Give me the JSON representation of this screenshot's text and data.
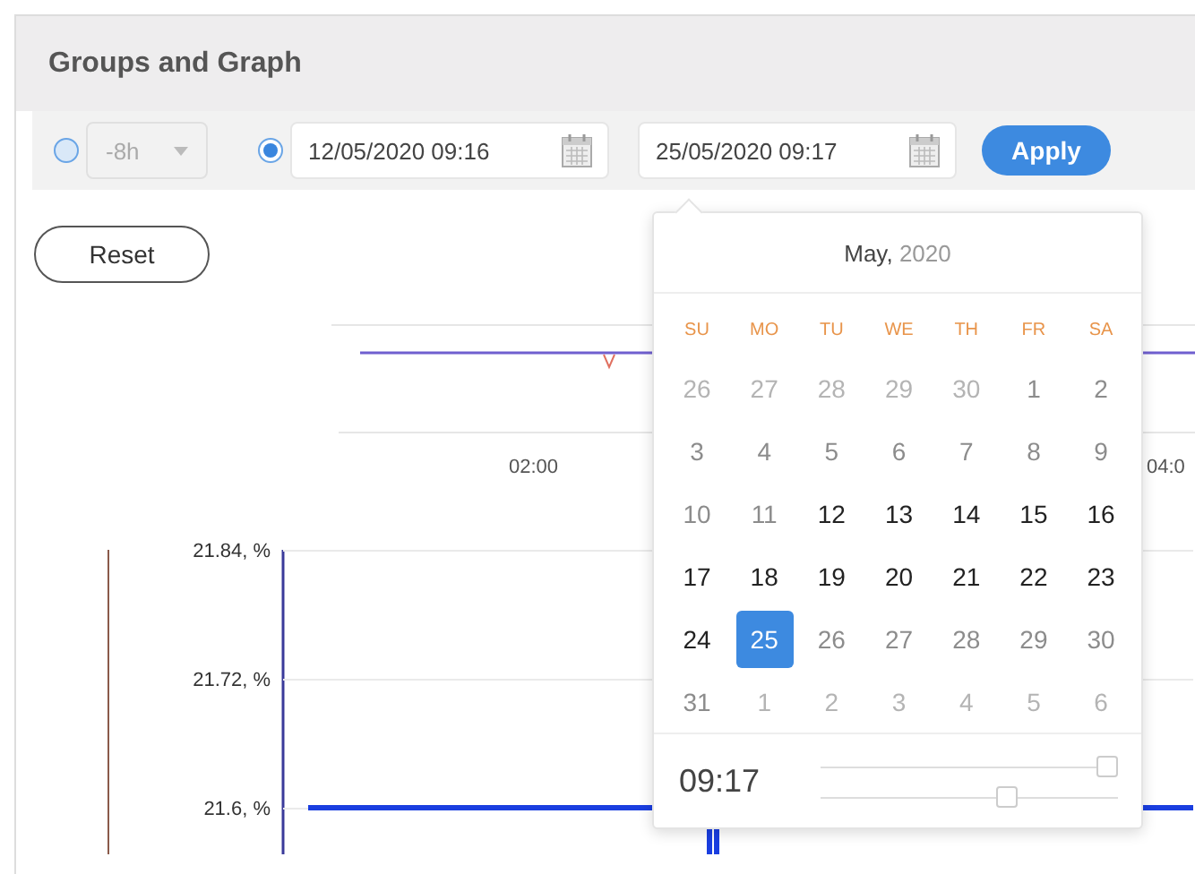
{
  "panel": {
    "title": "Groups and Graph"
  },
  "toolbar": {
    "relative": {
      "selected": false,
      "value": "-8h",
      "disabled": true
    },
    "absolute": {
      "selected": true
    },
    "from": "12/05/2020 09:16",
    "to": "25/05/2020 09:17",
    "apply": "Apply"
  },
  "reset": "Reset",
  "overview_chart": {
    "x_labels": [
      "02:00",
      "04:0"
    ]
  },
  "main_chart": {
    "y_labels": [
      "21.84, %",
      "21.72, %",
      "21.6, %"
    ]
  },
  "calendar": {
    "month": "May,",
    "year": "2020",
    "weekdays": [
      "SU",
      "MO",
      "TU",
      "WE",
      "TH",
      "FR",
      "SA"
    ],
    "days": [
      {
        "label": "26",
        "kind": "other",
        "selected": false
      },
      {
        "label": "27",
        "kind": "other",
        "selected": false
      },
      {
        "label": "28",
        "kind": "other",
        "selected": false
      },
      {
        "label": "29",
        "kind": "other",
        "selected": false
      },
      {
        "label": "30",
        "kind": "other",
        "selected": false
      },
      {
        "label": "1",
        "kind": "disabled",
        "selected": false
      },
      {
        "label": "2",
        "kind": "disabled",
        "selected": false
      },
      {
        "label": "3",
        "kind": "disabled",
        "selected": false
      },
      {
        "label": "4",
        "kind": "disabled",
        "selected": false
      },
      {
        "label": "5",
        "kind": "disabled",
        "selected": false
      },
      {
        "label": "6",
        "kind": "disabled",
        "selected": false
      },
      {
        "label": "7",
        "kind": "disabled",
        "selected": false
      },
      {
        "label": "8",
        "kind": "disabled",
        "selected": false
      },
      {
        "label": "9",
        "kind": "disabled",
        "selected": false
      },
      {
        "label": "10",
        "kind": "disabled",
        "selected": false
      },
      {
        "label": "11",
        "kind": "disabled",
        "selected": false
      },
      {
        "label": "12",
        "kind": "available",
        "selected": false
      },
      {
        "label": "13",
        "kind": "available",
        "selected": false
      },
      {
        "label": "14",
        "kind": "available",
        "selected": false
      },
      {
        "label": "15",
        "kind": "available",
        "selected": false
      },
      {
        "label": "16",
        "kind": "available",
        "selected": false
      },
      {
        "label": "17",
        "kind": "available",
        "selected": false
      },
      {
        "label": "18",
        "kind": "available",
        "selected": false
      },
      {
        "label": "19",
        "kind": "available",
        "selected": false
      },
      {
        "label": "20",
        "kind": "available",
        "selected": false
      },
      {
        "label": "21",
        "kind": "available",
        "selected": false
      },
      {
        "label": "22",
        "kind": "available",
        "selected": false
      },
      {
        "label": "23",
        "kind": "available",
        "selected": false
      },
      {
        "label": "24",
        "kind": "available",
        "selected": false
      },
      {
        "label": "25",
        "kind": "available",
        "selected": true
      },
      {
        "label": "26",
        "kind": "disabled",
        "selected": false
      },
      {
        "label": "27",
        "kind": "disabled",
        "selected": false
      },
      {
        "label": "28",
        "kind": "disabled",
        "selected": false
      },
      {
        "label": "29",
        "kind": "disabled",
        "selected": false
      },
      {
        "label": "30",
        "kind": "disabled",
        "selected": false
      },
      {
        "label": "31",
        "kind": "disabled",
        "selected": false
      },
      {
        "label": "1",
        "kind": "other",
        "selected": false
      },
      {
        "label": "2",
        "kind": "other",
        "selected": false
      },
      {
        "label": "3",
        "kind": "other",
        "selected": false
      },
      {
        "label": "4",
        "kind": "other",
        "selected": false
      },
      {
        "label": "5",
        "kind": "other",
        "selected": false
      },
      {
        "label": "6",
        "kind": "other",
        "selected": false
      }
    ],
    "time": "09:17",
    "hour_slider": {
      "level": 1.0
    },
    "minute_slider": {
      "level": 0.66
    }
  }
}
